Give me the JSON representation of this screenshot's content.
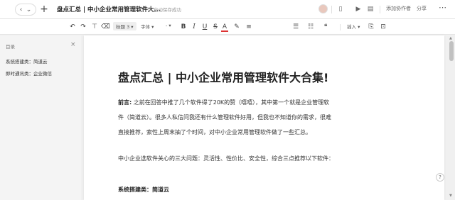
{
  "titlebar": {
    "back": "‹",
    "forward": "⌄",
    "new": "+",
    "title": "盘点汇总 | 中小企业常用管理软件大...",
    "save_status": "自动保存成功",
    "invite": "添加协作者",
    "share": "分享",
    "more": "⋯"
  },
  "toolbar": {
    "undo": "↶",
    "redo": "↷",
    "format_painter": "⊤",
    "clear": "⌫",
    "heading": "标题 3 ▾",
    "font": "字体 ▾",
    "size": "- ▾",
    "bold": "B",
    "italic": "I",
    "underline": "U",
    "strike": "S",
    "font_color": "A",
    "highlight": "✎",
    "align": "≡",
    "list_ul": "☰",
    "list_ol": "☷",
    "quote": "❝",
    "insert": "插入 ▾",
    "comment": "⎘",
    "chat": "⊡"
  },
  "sidebar": {
    "heading": "目录",
    "close": "×",
    "items": [
      {
        "label": "系统搭建类：简道云"
      },
      {
        "label": "即时通讯类：企业微信"
      }
    ]
  },
  "document": {
    "title": "盘点汇总 | 中小企业常用管理软件大合集!",
    "intro_label": "前言:",
    "intro_line1": "之前在回答中推了几个软件得了20K的赞（嘻嘻），其中第一个就是企业管理软",
    "intro_line2": "件（简道云）。很多人私信问我还有什么管理软件好用，但我也不知道你的需求，很难",
    "intro_line3": "直接推荐，索性上周末抽了个时间，对中小企业常用管理软件做了一些汇总。",
    "para2": "中小企业选软件关心的三大问题：灵活性、性价比、安全性，综合三点推荐以下软件：",
    "section_heading": "系统搭建类：简道云"
  },
  "help": "?"
}
